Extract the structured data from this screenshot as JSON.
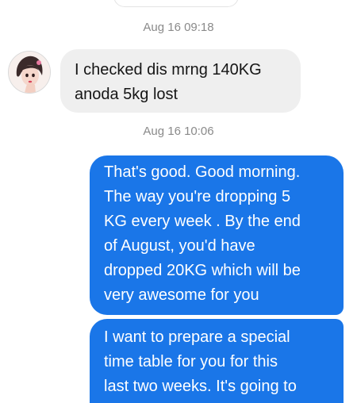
{
  "conversation": {
    "timestamps": [
      "Aug 16 09:18",
      "Aug 16 10:06"
    ],
    "incoming": {
      "avatar_icon": "contact-avatar",
      "lines": [
        "I checked dis mrng 140KG",
        "anoda 5kg lost"
      ]
    },
    "outgoing": [
      {
        "lines": [
          "That's good. Good morning.",
          "The way you're dropping 5",
          "KG every week . By the end",
          "of August, you'd have",
          "dropped 20KG which will be",
          "very awesome for you"
        ]
      },
      {
        "lines": [
          "I want to prepare a special",
          "time table for you for this",
          "last two weeks. It's going to"
        ]
      }
    ]
  },
  "colors": {
    "outgoing_bubble": "#1a76e8",
    "incoming_bubble": "#efefef",
    "timestamp_text": "#8a8a8a"
  }
}
